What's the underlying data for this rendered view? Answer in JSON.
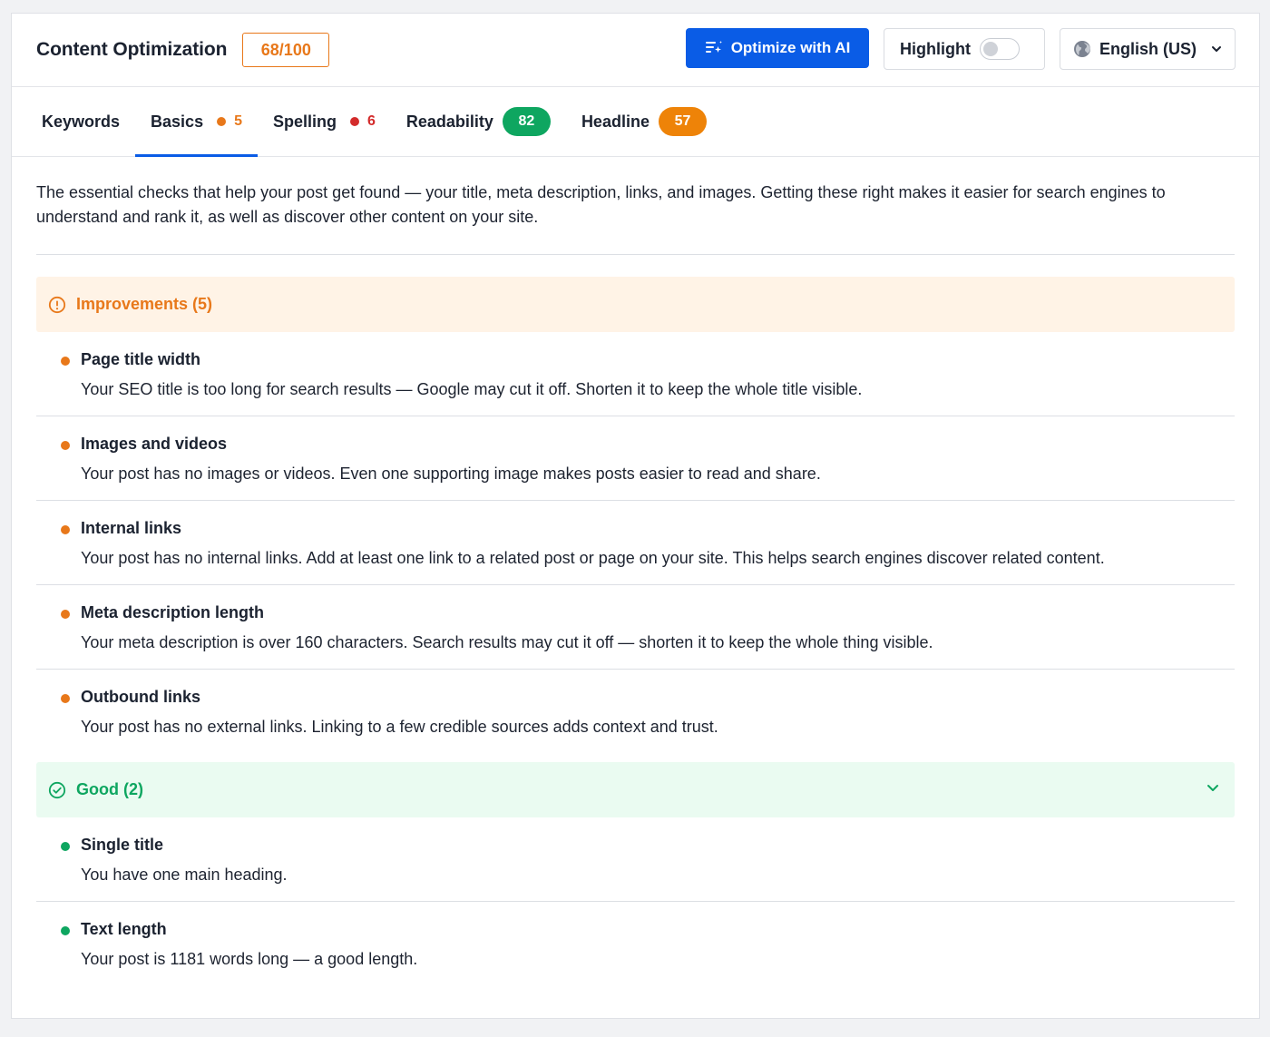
{
  "header": {
    "title": "Content Optimization",
    "score": "68/100",
    "optimize_label": "Optimize with AI",
    "highlight_label": "Highlight",
    "highlight_on": false,
    "language": "English (US)"
  },
  "tabs": [
    {
      "label": "Keywords"
    },
    {
      "label": "Basics",
      "count": "5",
      "count_color": "#e8781a",
      "active": true
    },
    {
      "label": "Spelling",
      "count": "6",
      "count_color": "#d32b2b"
    },
    {
      "label": "Readability",
      "score": "82",
      "score_color": "#0ea660"
    },
    {
      "label": "Headline",
      "score": "57",
      "score_color": "#ee8308"
    }
  ],
  "intro": "The essential checks that help your post get found — your title, meta description, links, and images. Getting these right makes it easier for search engines to understand and rank it, as well as discover other content on your site.",
  "improvements": {
    "heading": "Improvements (5)",
    "color": "#e8781a",
    "bg": "#fff3e6",
    "items": [
      {
        "title": "Page title width",
        "desc": "Your SEO title is too long for search results — Google may cut it off. Shorten it to keep the whole title visible."
      },
      {
        "title": "Images and videos",
        "desc": "Your post has no images or videos. Even one supporting image makes posts easier to read and share."
      },
      {
        "title": "Internal links",
        "desc": "Your post has no internal links. Add at least one link to a related post or page on your site. This helps search engines discover related content."
      },
      {
        "title": "Meta description length",
        "desc": "Your meta description is over 160 characters. Search results may cut it off — shorten it to keep the whole thing visible."
      },
      {
        "title": "Outbound links",
        "desc": "Your post has no external links. Linking to a few credible sources adds context and trust."
      }
    ]
  },
  "good": {
    "heading": "Good (2)",
    "color": "#0ea660",
    "bg": "#eafbf1",
    "items": [
      {
        "title": "Single title",
        "desc": "You have one main heading."
      },
      {
        "title": "Text length",
        "desc": "Your post is 1181 words long — a good length."
      }
    ]
  },
  "icons": {
    "optimize": "sparkle-list-icon",
    "language": "globe-icon",
    "dropdown": "chevron-down-icon",
    "improvements": "alert-circle-icon",
    "good": "check-circle-icon",
    "collapse": "chevron-down-icon"
  }
}
